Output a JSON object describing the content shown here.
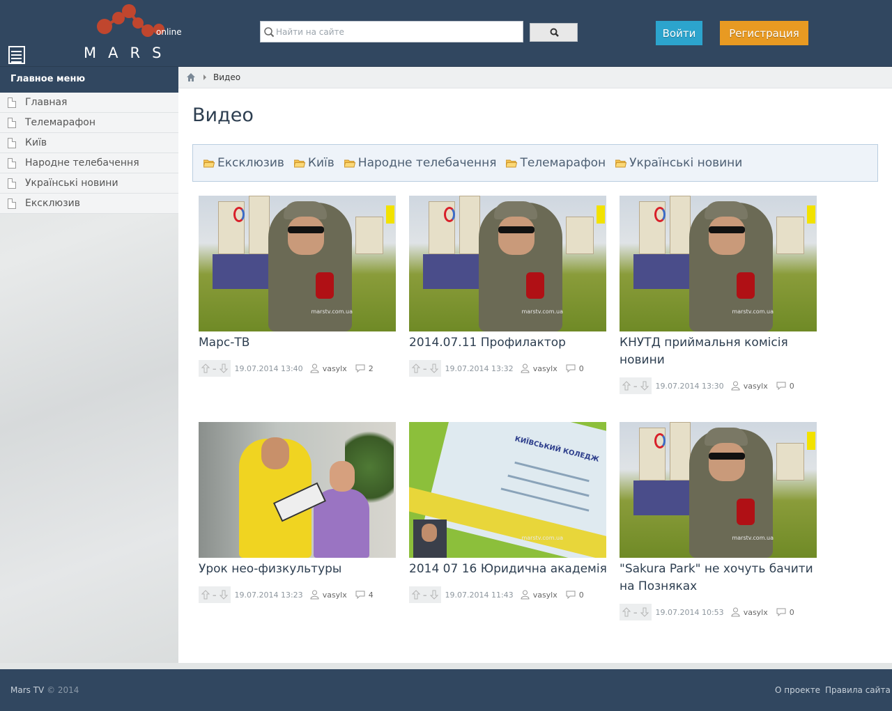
{
  "header": {
    "logo_word": "MARS",
    "logo_sub": "online",
    "search": {
      "placeholder": "Найти на сайте"
    },
    "login_label": "Войти",
    "register_label": "Регистрация"
  },
  "sidebar": {
    "title": "Главное меню",
    "items": [
      {
        "label": "Главная"
      },
      {
        "label": "Телемарафон"
      },
      {
        "label": "Київ"
      },
      {
        "label": "Народне телебачення"
      },
      {
        "label": "Українські новини"
      },
      {
        "label": "Ексклюзив"
      }
    ]
  },
  "breadcrumb": {
    "current": "Видео"
  },
  "page": {
    "title": "Видео"
  },
  "categories": [
    {
      "label": "Ексклюзив"
    },
    {
      "label": "Київ"
    },
    {
      "label": "Народне телебачення"
    },
    {
      "label": "Телемарафон"
    },
    {
      "label": "Українські новини"
    }
  ],
  "videos": [
    {
      "title": "Марс-ТВ",
      "votes": "–",
      "date": "19.07.2014 13:40",
      "user": "vasylx",
      "comments": "2"
    },
    {
      "title": "2014.07.11 Профилактор",
      "votes": "–",
      "date": "19.07.2014 13:32",
      "user": "vasylx",
      "comments": "0"
    },
    {
      "title": "КНУТД приймальня комісія новини",
      "votes": "–",
      "date": "19.07.2014 13:30",
      "user": "vasylx",
      "comments": "0"
    },
    {
      "title": "Урок нео-физкультуры",
      "votes": "–",
      "date": "19.07.2014 13:23",
      "user": "vasylx",
      "comments": "4"
    },
    {
      "title": "2014 07 16 Юридична академія",
      "votes": "–",
      "date": "19.07.2014 11:43",
      "user": "vasylx",
      "comments": "0"
    },
    {
      "title": "\"Sakura Park\" не хочуть бачити на Позняках",
      "votes": "–",
      "date": "19.07.2014 10:53",
      "user": "vasylx",
      "comments": "0"
    }
  ],
  "thumbs": {
    "watermark": "marstv.com.ua",
    "college_heading": "КИЇВСЬКИЙ КОЛЕДЖ"
  },
  "footer": {
    "brand": "Mars TV",
    "copyright": "© 2014",
    "links": [
      {
        "label": "О проекте"
      },
      {
        "label": "Правила сайта"
      }
    ]
  },
  "colors": {
    "header_bg": "#314760",
    "login_btn": "#2ca4cd",
    "register_btn": "#e89a22",
    "logo_dots": "#c0462e"
  }
}
